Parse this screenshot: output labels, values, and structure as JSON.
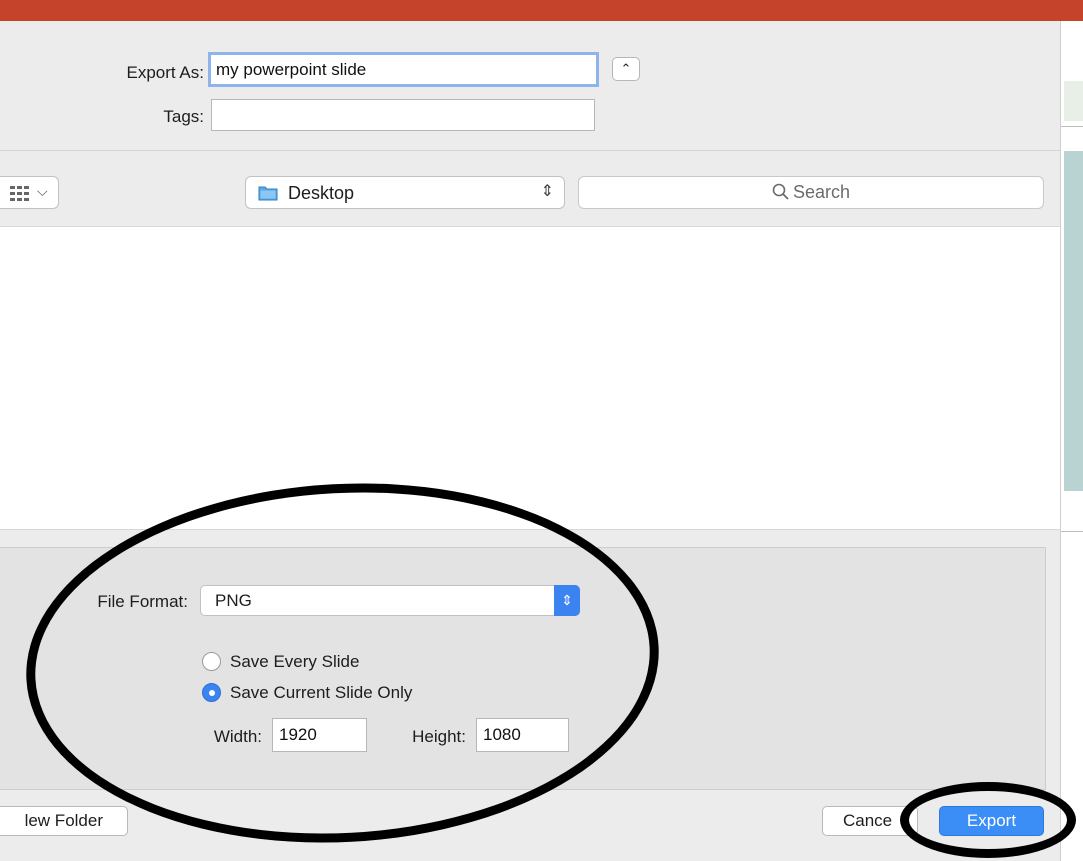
{
  "export_as": {
    "label": "Export As:",
    "value": "my powerpoint slide"
  },
  "tags": {
    "label": "Tags:",
    "value": ""
  },
  "toolbar": {
    "location": "Desktop",
    "search_placeholder": "Search",
    "icons": {
      "view": "grid-view-icon",
      "expand": "chevron-up-icon",
      "folder": "folder-icon",
      "search": "magnifier-icon"
    }
  },
  "options": {
    "file_format_label": "File Format:",
    "file_format_value": "PNG",
    "radios": [
      {
        "label": "Save Every Slide",
        "selected": false
      },
      {
        "label": "Save Current Slide Only",
        "selected": true
      }
    ],
    "width_label": "Width:",
    "width_value": "1920",
    "height_label": "Height:",
    "height_value": "1080"
  },
  "buttons": {
    "new_folder": "lew Folder",
    "cancel": "Cance",
    "export": "Export"
  },
  "colors": {
    "accent": "#3a83f1",
    "titlebar": "#c4432a"
  }
}
